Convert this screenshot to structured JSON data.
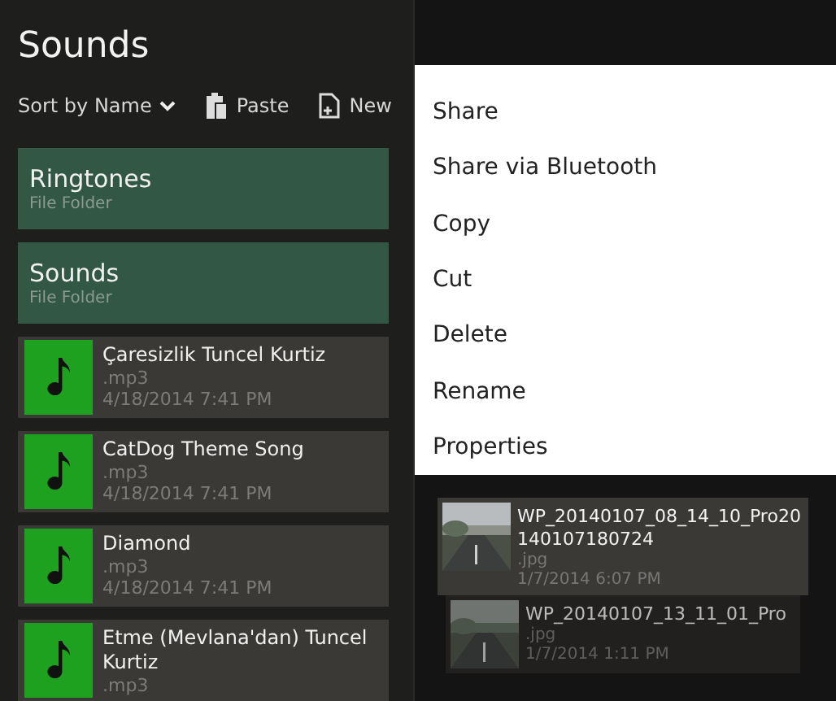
{
  "left_pane": {
    "title": "Sounds",
    "sort": {
      "label": "Sort by Name"
    },
    "actions": [
      {
        "kind": "paste",
        "label": "Paste"
      },
      {
        "kind": "new",
        "label": "New"
      }
    ],
    "items": [
      {
        "kind": "folder",
        "name": "Ringtones",
        "type": "File Folder"
      },
      {
        "kind": "folder",
        "name": "Sounds",
        "type": "File Folder"
      },
      {
        "kind": "audio",
        "name": "Çaresizlik Tuncel Kurtiz",
        "type": ".mp3",
        "date": "4/18/2014 7:41 PM"
      },
      {
        "kind": "audio",
        "name": "CatDog Theme Song",
        "type": ".mp3",
        "date": "4/18/2014 7:41 PM"
      },
      {
        "kind": "audio",
        "name": "Diamond",
        "type": ".mp3",
        "date": "4/18/2014 7:41 PM"
      },
      {
        "kind": "audio",
        "name": "Etme (Mevlana'dan) Tuncel Kurtiz",
        "type": ".mp3"
      }
    ]
  },
  "right_pane": {
    "context_menu": [
      "Share",
      "Share via Bluetooth",
      "Copy",
      "Cut",
      "Delete",
      "Rename",
      "Properties"
    ],
    "items": [
      {
        "kind": "picture",
        "name": "WP_20140107_08_14_10_Pro20140107180724",
        "type": ".jpg",
        "date": "1/7/2014 6:07 PM",
        "selected": true
      },
      {
        "kind": "picture",
        "name": "WP_20140107_13_11_01_Pro",
        "type": ".jpg",
        "date": "1/7/2014 1:11 PM",
        "selected": false
      }
    ]
  }
}
